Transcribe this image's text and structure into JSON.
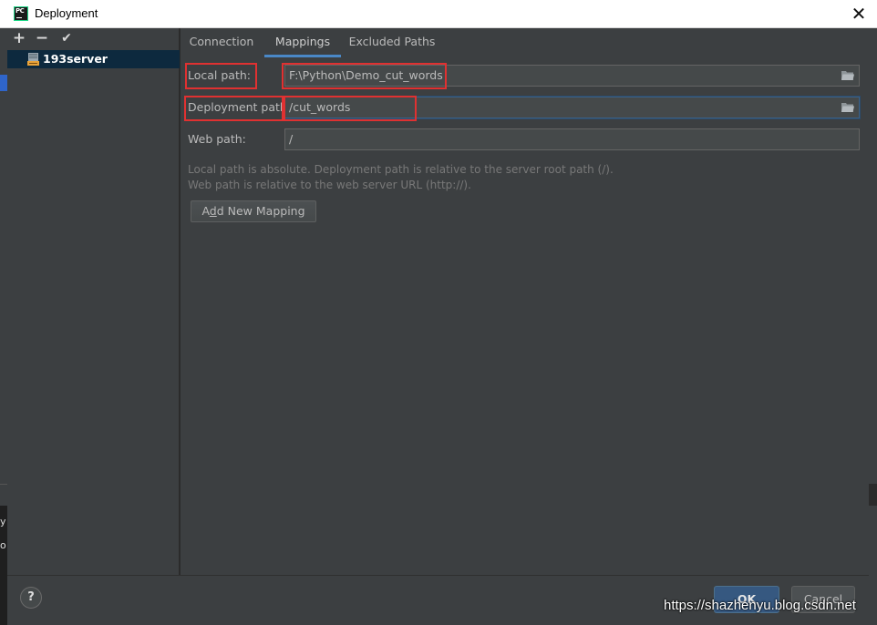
{
  "window": {
    "title": "Deployment",
    "app_icon_letters": "PC",
    "close_glyph": "✕"
  },
  "sidebar": {
    "toolbar": {
      "add": "+",
      "remove": "−",
      "apply": "✔"
    },
    "servers": [
      {
        "label": "193server",
        "icon": "sftp-server-icon",
        "selected": true
      }
    ]
  },
  "tabs": [
    {
      "label": "Connection",
      "active": false
    },
    {
      "label": "Mappings",
      "active": true
    },
    {
      "label": "Excluded Paths",
      "active": false
    }
  ],
  "mappings": {
    "local_path": {
      "label": "Local path:",
      "value": "F:\\Python\\Demo_cut_words"
    },
    "deployment_path": {
      "label": "Deployment path:",
      "value": "/cut_words"
    },
    "web_path": {
      "label": "Web path:",
      "value": "/"
    },
    "hint_line1": "Local path is absolute. Deployment path is relative to the server root path (/).",
    "hint_line2": "Web path is relative to the web server URL (http://).",
    "add_button_prefix": "A",
    "add_button_mnemonic": "d",
    "add_button_suffix": "d New Mapping"
  },
  "footer": {
    "help": "?",
    "ok": "OK",
    "cancel": "Cancel"
  },
  "background_fragments": {
    "char1": "y",
    "char2": "o"
  },
  "watermark": "https://shazhenyu.blog.csdn.net",
  "colors": {
    "accent": "#4a88c7",
    "highlight_box": "#e03131",
    "selection": "#0d293e"
  }
}
